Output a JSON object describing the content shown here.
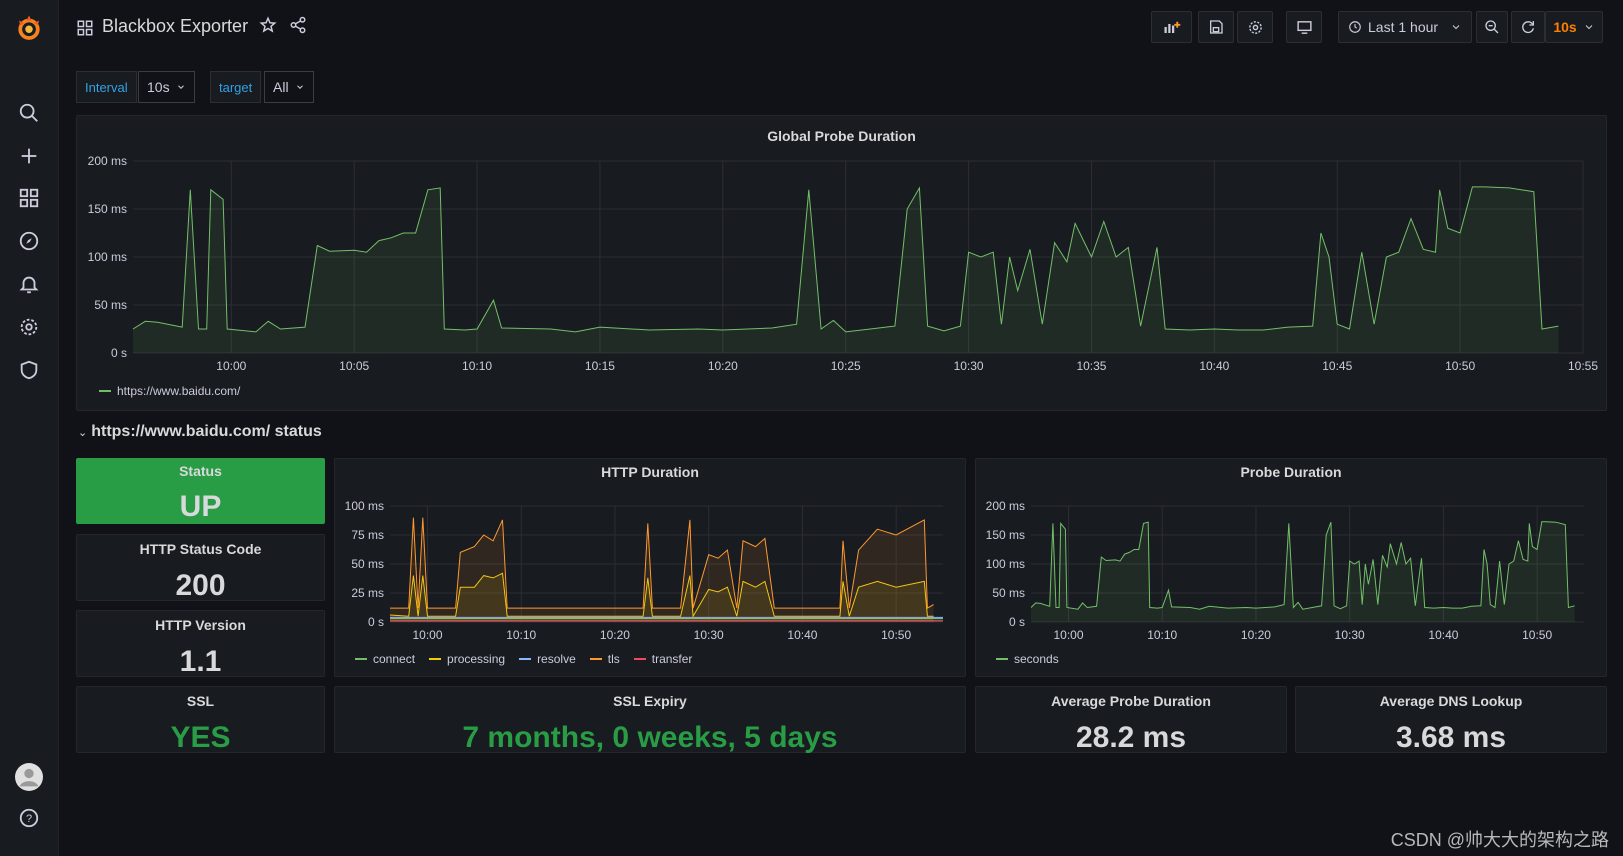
{
  "app": {
    "title": "Blackbox Exporter"
  },
  "toolbar": {
    "time_range": "Last 1 hour",
    "refresh": "10s"
  },
  "variables": [
    {
      "label": "Interval",
      "value": "10s"
    },
    {
      "label": "target",
      "value": "All"
    }
  ],
  "global_panel": {
    "title": "Global Probe Duration",
    "legend": "https://www.baidu.com/"
  },
  "row": {
    "title": "https://www.baidu.com/ status"
  },
  "stats": {
    "status": {
      "title": "Status",
      "value": "UP",
      "color": "#299c46"
    },
    "http_status_code": {
      "title": "HTTP Status Code",
      "value": "200"
    },
    "http_version": {
      "title": "HTTP Version",
      "value": "1.1"
    },
    "ssl": {
      "title": "SSL",
      "value": "YES",
      "color": "#299c46"
    },
    "ssl_expiry": {
      "title": "SSL Expiry",
      "value": "7 months, 0 weeks, 5 days",
      "color": "#299c46"
    },
    "avg_probe": {
      "title": "Average Probe Duration",
      "value": "28.2 ms"
    },
    "avg_dns": {
      "title": "Average DNS Lookup",
      "value": "3.68 ms"
    }
  },
  "http_panel": {
    "title": "HTTP Duration"
  },
  "probe_panel": {
    "title": "Probe Duration"
  },
  "watermark": "CSDN @帅大大的架构之路",
  "colors": {
    "green": "#73bf69",
    "yellow": "#f2cc0c",
    "orange": "#ff9830",
    "blue": "#8ab8ff",
    "red": "#f2495c",
    "accent": "#ff7f00"
  },
  "chart_data": [
    {
      "type": "line",
      "title": "Global Probe Duration",
      "y_ticks": [
        "200 ms",
        "150 ms",
        "100 ms",
        "50 ms",
        "0 s"
      ],
      "ylim": [
        0,
        200
      ],
      "x_ticks": [
        "10:00",
        "10:05",
        "10:10",
        "10:15",
        "10:20",
        "10:25",
        "10:30",
        "10:35",
        "10:40",
        "10:45",
        "10:50",
        "10:55"
      ],
      "xlim": [
        "09:56",
        "10:55"
      ],
      "series": [
        {
          "name": "https://www.baidu.com/",
          "color": "#73bf69",
          "values": [
            [
              "09:56",
              25
            ],
            [
              "09:56:30",
              33
            ],
            [
              "09:57",
              32
            ],
            [
              "09:58",
              27
            ],
            [
              "09:58:20",
              170
            ],
            [
              "09:58:40",
              25
            ],
            [
              "09:59",
              25
            ],
            [
              "09:59:10",
              170
            ],
            [
              "09:59:40",
              160
            ],
            [
              "09:59:50",
              25
            ],
            [
              "10:01",
              22
            ],
            [
              "10:01:30",
              33
            ],
            [
              "10:02",
              25
            ],
            [
              "10:03",
              27
            ],
            [
              "10:03:30",
              112
            ],
            [
              "10:04",
              106
            ],
            [
              "10:05",
              107
            ],
            [
              "10:05:30",
              105
            ],
            [
              "10:06",
              117
            ],
            [
              "10:06:30",
              120
            ],
            [
              "10:07",
              125
            ],
            [
              "10:07:30",
              125
            ],
            [
              "10:08",
              170
            ],
            [
              "10:08:30",
              172
            ],
            [
              "10:08:40",
              25
            ],
            [
              "10:09:30",
              24
            ],
            [
              "10:10",
              25
            ],
            [
              "10:10:40",
              55
            ],
            [
              "10:11",
              26
            ],
            [
              "10:13",
              25
            ],
            [
              "10:14",
              22
            ],
            [
              "10:15",
              27
            ],
            [
              "10:17",
              24
            ],
            [
              "10:19",
              25
            ],
            [
              "10:20",
              24
            ],
            [
              "10:22",
              26
            ],
            [
              "10:23",
              30
            ],
            [
              "10:23:30",
              170
            ],
            [
              "10:24",
              25
            ],
            [
              "10:24:30",
              34
            ],
            [
              "10:25",
              22
            ],
            [
              "10:26",
              25
            ],
            [
              "10:27",
              28
            ],
            [
              "10:27:30",
              150
            ],
            [
              "10:28",
              172
            ],
            [
              "10:28:20",
              28
            ],
            [
              "10:29",
              23
            ],
            [
              "10:29:40",
              28
            ],
            [
              "10:30",
              105
            ],
            [
              "10:30:30",
              100
            ],
            [
              "10:31",
              105
            ],
            [
              "10:31:20",
              30
            ],
            [
              "10:31:40",
              100
            ],
            [
              "10:32",
              65
            ],
            [
              "10:32:30",
              108
            ],
            [
              "10:33",
              30
            ],
            [
              "10:33:30",
              115
            ],
            [
              "10:34",
              95
            ],
            [
              "10:34:20",
              135
            ],
            [
              "10:35",
              100
            ],
            [
              "10:35:30",
              137
            ],
            [
              "10:36",
              100
            ],
            [
              "10:36:30",
              110
            ],
            [
              "10:37",
              28
            ],
            [
              "10:37:40",
              110
            ],
            [
              "10:38",
              25
            ],
            [
              "10:39",
              24
            ],
            [
              "10:40",
              25
            ],
            [
              "10:41",
              24
            ],
            [
              "10:42",
              24
            ],
            [
              "10:43",
              27
            ],
            [
              "10:44",
              28
            ],
            [
              "10:44:20",
              125
            ],
            [
              "10:44:40",
              100
            ],
            [
              "10:45",
              30
            ],
            [
              "10:45:30",
              25
            ],
            [
              "10:46",
              105
            ],
            [
              "10:46:30",
              30
            ],
            [
              "10:47",
              100
            ],
            [
              "10:47:30",
              105
            ],
            [
              "10:48",
              140
            ],
            [
              "10:48:30",
              108
            ],
            [
              "10:49",
              105
            ],
            [
              "10:49:10",
              170
            ],
            [
              "10:49:30",
              130
            ],
            [
              "10:50",
              125
            ],
            [
              "10:50:30",
              173
            ],
            [
              "10:51",
              173
            ],
            [
              "10:52",
              172
            ],
            [
              "10:53",
              168
            ],
            [
              "10:53:20",
              25
            ],
            [
              "10:54",
              28
            ]
          ]
        }
      ]
    },
    {
      "type": "line",
      "title": "HTTP Duration",
      "y_ticks": [
        "100 ms",
        "75 ms",
        "50 ms",
        "25 ms",
        "0 s"
      ],
      "ylim": [
        0,
        100
      ],
      "x_ticks": [
        "10:00",
        "10:10",
        "10:20",
        "10:30",
        "10:40",
        "10:50"
      ],
      "xlim": [
        "09:56",
        "10:55"
      ],
      "series": [
        {
          "name": "connect",
          "color": "#73bf69",
          "values": [
            [
              "09:56",
              3
            ],
            [
              "10:55",
              3
            ]
          ]
        },
        {
          "name": "processing",
          "color": "#f2cc0c",
          "values": [
            [
              "09:56",
              6
            ],
            [
              "09:58",
              5
            ],
            [
              "09:58:30",
              40
            ],
            [
              "09:59",
              5
            ],
            [
              "09:59:30",
              40
            ],
            [
              "10:00",
              5
            ],
            [
              "10:03",
              5
            ],
            [
              "10:03:30",
              30
            ],
            [
              "10:05",
              30
            ],
            [
              "10:06",
              40
            ],
            [
              "10:07",
              38
            ],
            [
              "10:08",
              42
            ],
            [
              "10:08:30",
              5
            ],
            [
              "10:23",
              5
            ],
            [
              "10:23:30",
              38
            ],
            [
              "10:24",
              5
            ],
            [
              "10:27",
              5
            ],
            [
              "10:28",
              40
            ],
            [
              "10:28:20",
              5
            ],
            [
              "10:30",
              28
            ],
            [
              "10:31",
              26
            ],
            [
              "10:32",
              30
            ],
            [
              "10:33",
              5
            ],
            [
              "10:33:40",
              35
            ],
            [
              "10:35",
              30
            ],
            [
              "10:36",
              35
            ],
            [
              "10:37",
              5
            ],
            [
              "10:44",
              5
            ],
            [
              "10:44:20",
              35
            ],
            [
              "10:45",
              5
            ],
            [
              "10:46",
              30
            ],
            [
              "10:48",
              35
            ],
            [
              "10:50",
              30
            ],
            [
              "10:53",
              35
            ],
            [
              "10:53:20",
              5
            ],
            [
              "10:54",
              5
            ]
          ]
        },
        {
          "name": "resolve",
          "color": "#8ab8ff",
          "values": [
            [
              "09:56",
              4
            ],
            [
              "10:55",
              4
            ]
          ]
        },
        {
          "name": "tls",
          "color": "#ff9830",
          "values": [
            [
              "09:56",
              12
            ],
            [
              "09:58",
              12
            ],
            [
              "09:58:30",
              90
            ],
            [
              "09:59",
              12
            ],
            [
              "09:59:30",
              90
            ],
            [
              "10:00",
              12
            ],
            [
              "10:03",
              12
            ],
            [
              "10:03:30",
              60
            ],
            [
              "10:05",
              65
            ],
            [
              "10:06",
              75
            ],
            [
              "10:07",
              70
            ],
            [
              "10:08",
              88
            ],
            [
              "10:08:30",
              12
            ],
            [
              "10:23",
              12
            ],
            [
              "10:23:30",
              85
            ],
            [
              "10:24",
              12
            ],
            [
              "10:27",
              12
            ],
            [
              "10:28",
              88
            ],
            [
              "10:28:20",
              12
            ],
            [
              "10:30",
              58
            ],
            [
              "10:31",
              55
            ],
            [
              "10:32",
              62
            ],
            [
              "10:33",
              12
            ],
            [
              "10:33:40",
              70
            ],
            [
              "10:35",
              65
            ],
            [
              "10:36",
              72
            ],
            [
              "10:37",
              12
            ],
            [
              "10:44",
              12
            ],
            [
              "10:44:20",
              70
            ],
            [
              "10:45",
              12
            ],
            [
              "10:46",
              62
            ],
            [
              "10:48",
              80
            ],
            [
              "10:50",
              75
            ],
            [
              "10:53",
              88
            ],
            [
              "10:53:20",
              12
            ],
            [
              "10:54",
              15
            ]
          ]
        },
        {
          "name": "transfer",
          "color": "#f2495c",
          "values": [
            [
              "09:56",
              1
            ],
            [
              "10:55",
              1
            ]
          ]
        }
      ]
    },
    {
      "type": "line",
      "title": "Probe Duration",
      "y_ticks": [
        "200 ms",
        "150 ms",
        "100 ms",
        "50 ms",
        "0 s"
      ],
      "ylim": [
        0,
        200
      ],
      "x_ticks": [
        "10:00",
        "10:10",
        "10:20",
        "10:30",
        "10:40",
        "10:50"
      ],
      "xlim": [
        "09:56",
        "10:55"
      ],
      "series": [
        {
          "name": "seconds",
          "color": "#73bf69",
          "values": "same as Global Probe Duration"
        }
      ]
    }
  ]
}
